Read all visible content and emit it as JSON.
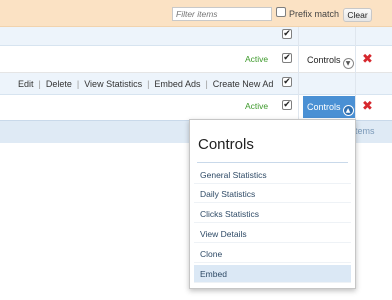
{
  "filter": {
    "placeholder": "Filter items",
    "prefix_match_label": "Prefix match",
    "prefix_match_checked": false,
    "clear_label": "Clear"
  },
  "rows": [
    {
      "checked": true
    },
    {
      "checked": true,
      "status": "Active",
      "controls_label": "Controls",
      "delete_icon": "close-icon"
    },
    {
      "checked": true,
      "links": [
        "Edit",
        "Delete",
        "View Statistics",
        "Embed Ads",
        "Create New Ad"
      ]
    },
    {
      "checked": true,
      "status": "Active",
      "controls_label": "Controls",
      "controls_open": true,
      "delete_icon": "close-icon"
    }
  ],
  "footer": {
    "text_fragment": "items"
  },
  "dropdown": {
    "title": "Controls",
    "items": [
      "General Statistics",
      "Daily Statistics",
      "Clicks Statistics",
      "View Details",
      "Clone",
      "Embed"
    ],
    "selected_index": 5
  },
  "colors": {
    "filter_bar": "#fbe2c4",
    "active_status": "#3d9a2b",
    "delete_icon": "#d6282e",
    "controls_active": "#4a90d4"
  }
}
